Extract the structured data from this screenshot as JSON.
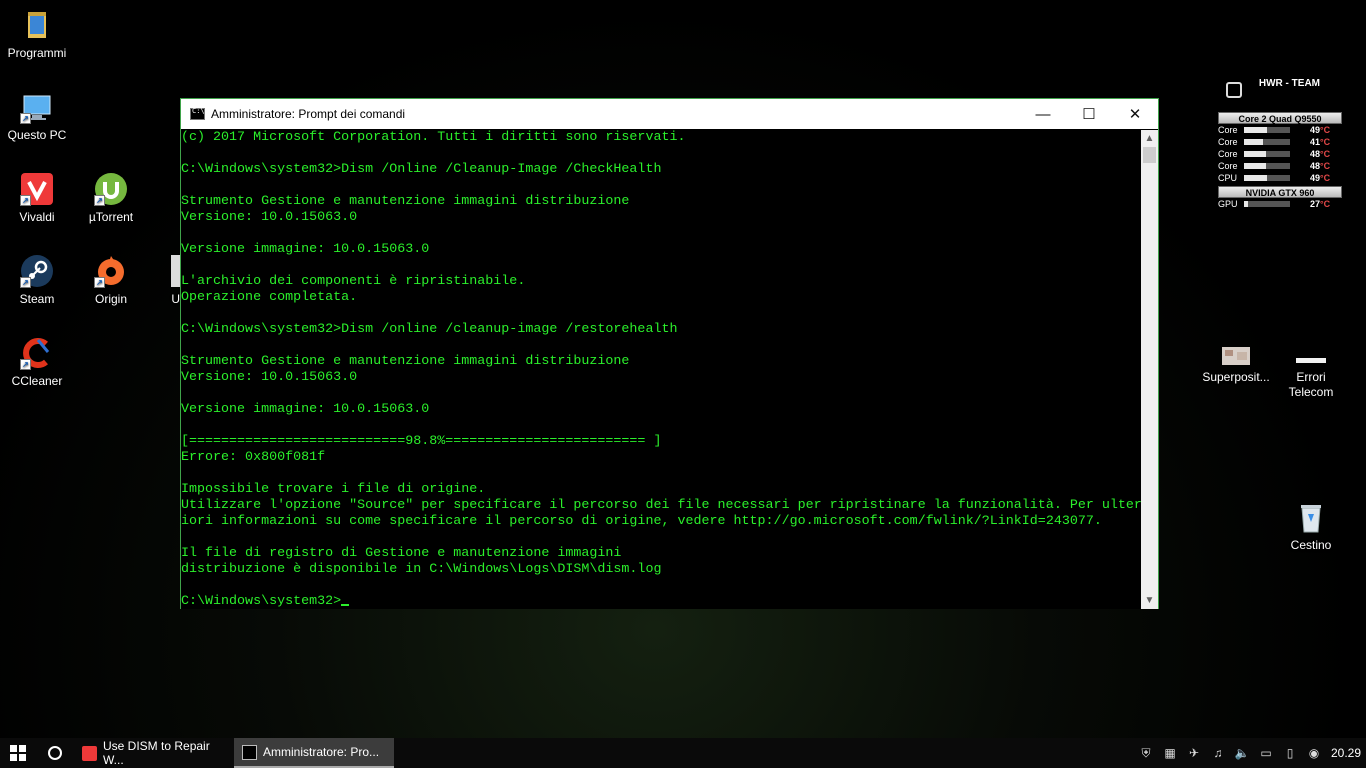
{
  "desktop": {
    "icons": [
      {
        "label": "Programmi",
        "icon": "folder-icon"
      },
      {
        "label": "Questo PC",
        "icon": "computer-icon"
      },
      {
        "label": "Vivaldi",
        "icon": "vivaldi-icon"
      },
      {
        "label": "µTorrent",
        "icon": "utorrent-icon"
      },
      {
        "label": "Steam",
        "icon": "steam-icon"
      },
      {
        "label": "Origin",
        "icon": "origin-icon"
      },
      {
        "label": "U",
        "icon": "app-icon"
      },
      {
        "label": "CCleaner",
        "icon": "ccleaner-icon"
      },
      {
        "label": "Superposit...",
        "icon": "superposition-icon"
      },
      {
        "label": "Errori Telecom",
        "icon": "document-icon"
      },
      {
        "label": "Cestino",
        "icon": "recycle-bin-icon"
      }
    ]
  },
  "gadget": {
    "title": "HWR - TEAM",
    "cpu_header": "Core 2 Quad Q9550",
    "cpu_rows": [
      {
        "label": "Core",
        "value": "49",
        "unit": "°C",
        "fill": 0.49
      },
      {
        "label": "Core",
        "value": "41",
        "unit": "°C",
        "fill": 0.41
      },
      {
        "label": "Core",
        "value": "48",
        "unit": "°C",
        "fill": 0.48
      },
      {
        "label": "Core",
        "value": "48",
        "unit": "°C",
        "fill": 0.48
      },
      {
        "label": "CPU",
        "value": "49",
        "unit": "°C",
        "fill": 0.49
      }
    ],
    "gpu_header": "NVIDIA GTX 960",
    "gpu_rows": [
      {
        "label": "GPU",
        "value": "27",
        "unit": "°C",
        "fill": 0.08
      }
    ]
  },
  "window": {
    "title": "Amministratore: Prompt dei comandi",
    "minimize": "—",
    "maximize": "☐",
    "close": "✕",
    "console_lines": [
      "(c) 2017 Microsoft Corporation. Tutti i diritti sono riservati.",
      "",
      "C:\\Windows\\system32>Dism /Online /Cleanup-Image /CheckHealth",
      "",
      "Strumento Gestione e manutenzione immagini distribuzione",
      "Versione: 10.0.15063.0",
      "",
      "Versione immagine: 10.0.15063.0",
      "",
      "L'archivio dei componenti è ripristinabile.",
      "Operazione completata.",
      "",
      "C:\\Windows\\system32>Dism /online /cleanup-image /restorehealth",
      "",
      "Strumento Gestione e manutenzione immagini distribuzione",
      "Versione: 10.0.15063.0",
      "",
      "Versione immagine: 10.0.15063.0",
      "",
      "[===========================98.8%========================= ]",
      "Errore: 0x800f081f",
      "",
      "Impossibile trovare i file di origine.",
      "Utilizzare l'opzione \"Source\" per specificare il percorso dei file necessari per ripristinare la funzionalità. Per ulter",
      "iori informazioni su come specificare il percorso di origine, vedere http://go.microsoft.com/fwlink/?LinkId=243077.",
      "",
      "Il file di registro di Gestione e manutenzione immagini",
      "distribuzione è disponibile in C:\\Windows\\Logs\\DISM\\dism.log",
      "",
      "C:\\Windows\\system32>"
    ]
  },
  "taskbar": {
    "apps": [
      {
        "label": "Use DISM to Repair W...",
        "icon": "vivaldi-icon",
        "active": false
      },
      {
        "label": "Amministratore: Pro...",
        "icon": "cmd-icon",
        "active": true
      }
    ],
    "clock": "20.29"
  }
}
